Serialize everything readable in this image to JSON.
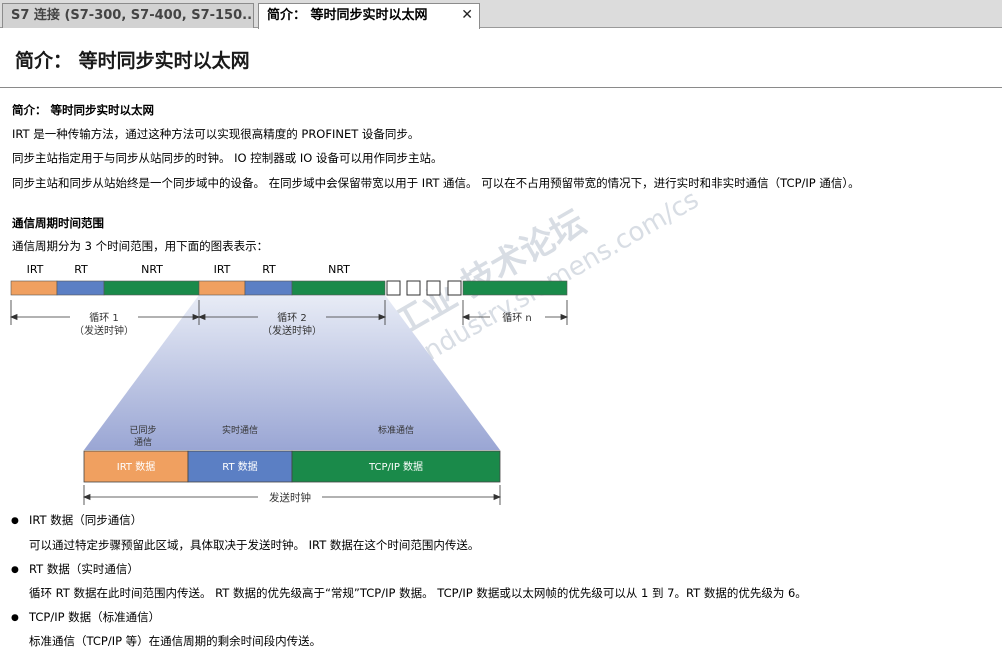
{
  "tabs": [
    {
      "label": "S7 连接 (S7-300, S7-400, S7-150..."
    },
    {
      "label": "简介： 等时同步实时以太网",
      "close": "✕"
    }
  ],
  "page_title": "简介： 等时同步实时以太网",
  "section1": {
    "heading": "简介： 等时同步实时以太网",
    "p1": "IRT 是一种传输方法，通过这种方法可以实现很高精度的 PROFINET 设备同步。",
    "p2": "同步主站指定用于与同步从站同步的时钟。 IO 控制器或 IO 设备可以用作同步主站。",
    "p3": "同步主站和同步从站始终是一个同步域中的设备。 在同步域中会保留带宽以用于 IRT 通信。 可以在不占用预留带宽的情况下，进行实时和非实时通信（TCP/IP 通信）。"
  },
  "section2": {
    "heading": "通信周期时间范围",
    "intro": "通信周期分为 3 个时间范围，用下面的图表表示："
  },
  "diagram": {
    "seg_labels": [
      "IRT",
      "RT",
      "NRT",
      "IRT",
      "RT",
      "NRT"
    ],
    "cycle1": "循环 1",
    "cycle1_sub": "（发送时钟）",
    "cycle2": "循环 2",
    "cycle2_sub": "（发送时钟）",
    "cyclen": "循环 n",
    "zoom_label1a": "已同步",
    "zoom_label1b": "通信",
    "zoom_label2": "实时通信",
    "zoom_label3": "标准通信",
    "zoom_seg1": "IRT 数据",
    "zoom_seg2": "RT 数据",
    "zoom_seg3": "TCP/IP 数据",
    "send_clock": "发送时钟",
    "colors": {
      "irt": "#f0a060",
      "rt": "#5b7fc4",
      "nrt": "#1a8a4a"
    }
  },
  "bullets": [
    {
      "title": "IRT 数据（同步通信）",
      "desc": "可以通过特定步骤预留此区域，具体取决于发送时钟。 IRT 数据在这个时间范围内传送。"
    },
    {
      "title": "RT 数据（实时通信）",
      "desc": "循环 RT 数据在此时间范围内传送。 RT 数据的优先级高于“常规”TCP/IP 数据。 TCP/IP 数据或以太网帧的优先级可以从 1 到 7。RT 数据的优先级为 6。"
    },
    {
      "title": "TCP/IP 数据（标准通信）",
      "desc": "标准通信（TCP/IP 等）在通信周期的剩余时间段内传送。"
    }
  ],
  "watermark": {
    "line1": "西门子工业 技术论坛",
    "line2": "support.industry.siemens.com/cs"
  }
}
